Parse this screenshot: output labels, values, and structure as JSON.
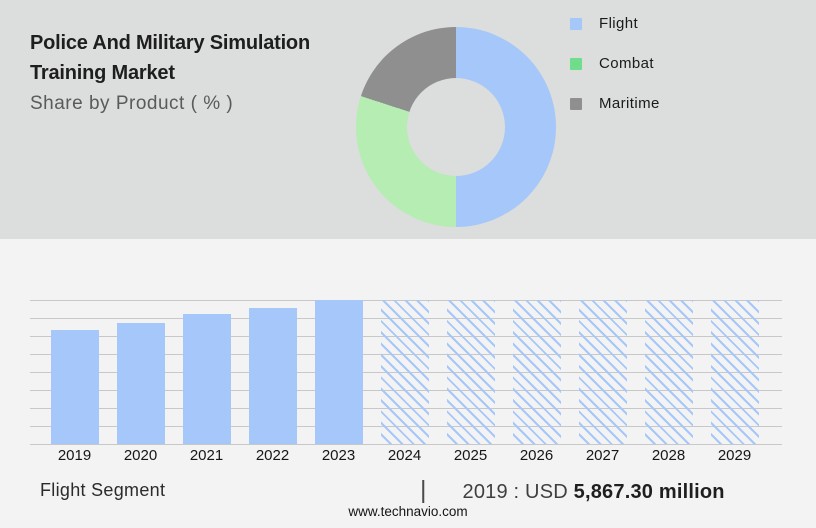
{
  "header": {
    "title_line1": "Police And Military Simulation",
    "title_line2": "Training Market",
    "subtitle": "Share by Product ( % )"
  },
  "palette": {
    "blue": "#a6c7f9",
    "donut_green": "#b5edb3",
    "legend_green": "#70dd8d",
    "gray": "#8f8f8f",
    "top_background": "#dcdddd"
  },
  "legend": {
    "items": [
      {
        "label": "Flight",
        "color": "#a6c7f9"
      },
      {
        "label": "Combat",
        "color": "#70dd8d"
      },
      {
        "label": "Maritime",
        "color": "#8f8f8f"
      }
    ]
  },
  "chart_data": [
    {
      "type": "pie",
      "donut": true,
      "title": "Share by Product ( % )",
      "labels": [
        "Flight",
        "Combat",
        "Maritime"
      ],
      "values": [
        50,
        30,
        20
      ],
      "colors": [
        "#a6c7f9",
        "#b5edb3",
        "#8f8f8f"
      ],
      "hole_color": "#dcdddd",
      "legend_position": "right",
      "start_angle_deg": 0
    },
    {
      "type": "bar",
      "categories": [
        "2019",
        "2020",
        "2021",
        "2022",
        "2023",
        "2024",
        "2025",
        "2026",
        "2027",
        "2028",
        "2029"
      ],
      "values": [
        5867.3,
        6230,
        6670,
        7000,
        7410,
        7410,
        7410,
        7410,
        7410,
        7410,
        7410
      ],
      "bar_color": "#a6c7f9",
      "forecast_start_index": 5,
      "forecast_style": "hatched",
      "labeled_value": {
        "year": "2019",
        "value": "USD 5,867.30 million"
      },
      "ylim": [
        0,
        7550
      ],
      "gridlines": 9,
      "note": "2020-2029 values estimated from bar heights; 2024-2029 drawn as equal-height hatched forecast bars"
    }
  ],
  "footer": {
    "segment_label": "Flight Segment",
    "separator": "|",
    "value_label": "2019 : USD ",
    "value_bold": "5,867.30 million",
    "website": "www.technavio.com"
  }
}
